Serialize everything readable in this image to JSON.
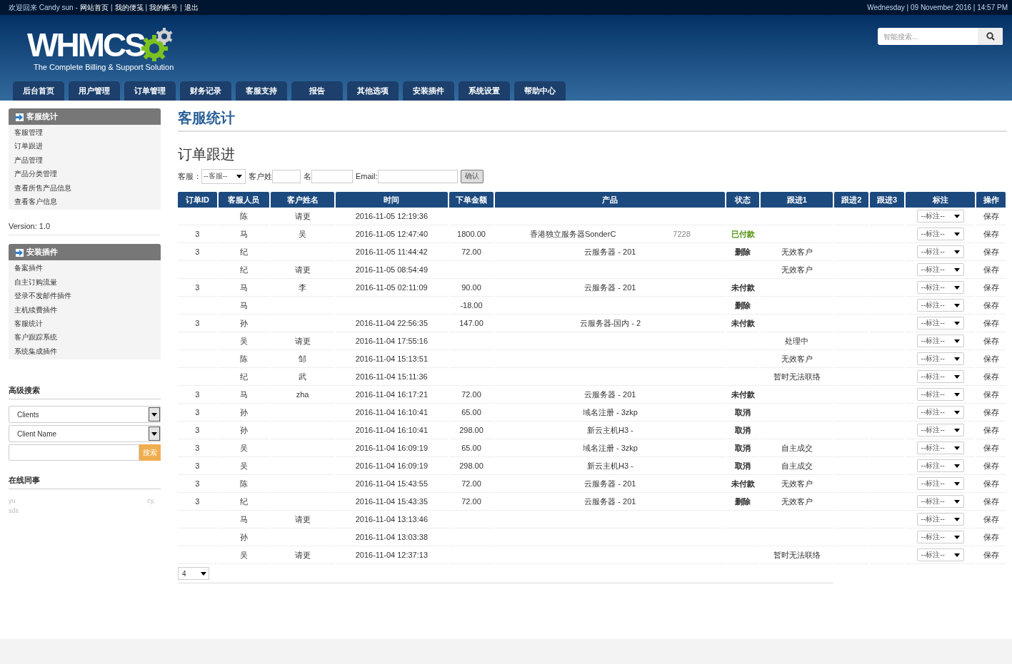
{
  "topbar": {
    "welcome": "欢迎回来 Candy sun",
    "dash": "-",
    "divider": "|",
    "links": [
      "网站首页",
      "我的便笺",
      "我的帐号",
      "退出"
    ],
    "datetime": "Wednesday | 09 November 2016 | 14:57 PM"
  },
  "header": {
    "logo": "WHMCS",
    "tagline": "The Complete Billing & Support Solution",
    "search": {
      "placeholder": "智能搜索..."
    }
  },
  "nav": [
    {
      "label": "后台首页",
      "selected": false
    },
    {
      "label": "用户管理",
      "selected": false
    },
    {
      "label": "订单管理",
      "selected": false
    },
    {
      "label": "财务记录",
      "selected": false
    },
    {
      "label": "客服支持",
      "selected": false
    },
    {
      "label": "报告",
      "selected": false
    },
    {
      "label": "其他选项",
      "selected": false
    },
    {
      "label": "安装插件",
      "selected": false
    },
    {
      "label": "系统设置",
      "selected": false
    },
    {
      "label": "帮助中心",
      "selected": false
    }
  ],
  "sidebar": {
    "panels": [
      {
        "title": "客服统计",
        "items": [
          "客服管理",
          "订单跟进",
          "产品管理",
          "产品分类管理",
          "查看所售产品信息",
          "查看客户信息"
        ],
        "footer": "Version: 1.0"
      },
      {
        "title": "安装插件",
        "items": [
          "备案插件",
          "自主订购流量",
          "登录不发邮件插件",
          "主机续费插件",
          "客服统计",
          "客户跟踪系统",
          "系统集成插件"
        ]
      }
    ],
    "advanced_search": {
      "title": "高级搜索",
      "selects": [
        "Clients",
        "Client Name"
      ],
      "button": "搜索"
    },
    "online": {
      "title": "在线同事",
      "names": [
        "yu",
        "sds"
      ],
      "suffix": "cy,"
    }
  },
  "main": {
    "title": "客服统计",
    "subtitle": "订单跟进",
    "filters": {
      "agent_label": "客服：",
      "agent_select": "--客服--",
      "last_label": "客户姓",
      "first_label": "名",
      "email_label": "Email:",
      "button": "确认"
    },
    "table": {
      "columns": [
        "订单ID",
        "客服人员",
        "客户姓名",
        "时间",
        "下单金额",
        "产品",
        "状态",
        "跟进1",
        "跟进2",
        "跟进3",
        "标注",
        "操作"
      ],
      "rows": [
        {
          "agent": "陈",
          "customer": "请更",
          "time": "2016-11-05 12:19:36",
          "remark": "--标注--",
          "action": "保存"
        },
        {
          "id": "3",
          "agent": "马",
          "customer": "吴",
          "time": "2016-11-05 12:47:40",
          "amount": "1800.00",
          "product": "香港独立服务器SonderC",
          "product_tail": "7228",
          "status": {
            "text": "已付款",
            "color": "#5a9a1a"
          },
          "remark": "--标注--",
          "action": "保存"
        },
        {
          "id": "3",
          "agent": "纪",
          "time": "2016-11-05 11:44:42",
          "amount": "72.00",
          "product": "云服务器 - 201",
          "status": {
            "text": "删除"
          },
          "follow1": "无效客户",
          "remark": "--标注--",
          "action": "保存"
        },
        {
          "agent": "纪",
          "customer": "请更",
          "time": "2016-11-05 08:54:49",
          "follow1": "无效客户",
          "remark": "--标注--",
          "action": "保存"
        },
        {
          "id": "3",
          "agent": "马",
          "customer": "李",
          "time": "2016-11-05 02:11:09",
          "amount": "90.00",
          "product": "云服务器 - 201",
          "status": {
            "text": "未付款"
          },
          "remark": "--标注--",
          "action": "保存"
        },
        {
          "agent": "马",
          "amount": "-18.00",
          "status": {
            "text": "删除"
          },
          "remark": "--标注--",
          "action": "保存"
        },
        {
          "id": "3",
          "agent": "孙",
          "time": "2016-11-04 22:56:35",
          "amount": "147.00",
          "product": "云服务器-国内 - 2",
          "status": {
            "text": "未付款"
          },
          "remark": "--标注--",
          "action": "保存"
        },
        {
          "agent": "吴",
          "customer": "请更",
          "time": "2016-11-04 17:55:16",
          "follow1": "处理中",
          "remark": "--标注--",
          "action": "保存"
        },
        {
          "agent": "陈",
          "customer": "邹",
          "time": "2016-11-04 15:13:51",
          "follow1": "无效客户",
          "remark": "--标注--",
          "action": "保存"
        },
        {
          "agent": "纪",
          "customer": "武",
          "time": "2016-11-04 15:11:36",
          "follow1": "暂时无法联络",
          "remark": "--标注--",
          "action": "保存"
        },
        {
          "id": "3",
          "agent": "马",
          "customer": "zha",
          "time": "2016-11-04 16:17:21",
          "amount": "72.00",
          "product": "云服务器 - 201",
          "status": {
            "text": "未付款"
          },
          "remark": "--标注--",
          "action": "保存"
        },
        {
          "id": "3",
          "agent": "孙",
          "time": "2016-11-04 16:10:41",
          "amount": "65.00",
          "product": "域名注册 - 3zkp",
          "status": {
            "text": "取消"
          },
          "remark": "--标注--",
          "action": "保存"
        },
        {
          "id": "3",
          "agent": "孙",
          "time": "2016-11-04 16:10:41",
          "amount": "298.00",
          "product": "新云主机H3 -",
          "status": {
            "text": "取消"
          },
          "remark": "--标注--",
          "action": "保存"
        },
        {
          "id": "3",
          "agent": "吴",
          "time": "2016-11-04 16:09:19",
          "amount": "65.00",
          "product": "域名注册 - 3zkp",
          "status": {
            "text": "取消"
          },
          "follow1": "自主成交",
          "remark": "--标注--",
          "action": "保存"
        },
        {
          "id": "3",
          "agent": "吴",
          "time": "2016-11-04 16:09:19",
          "amount": "298.00",
          "product": "新云主机H3 -",
          "status": {
            "text": "取消"
          },
          "follow1": "自主成交",
          "remark": "--标注--",
          "action": "保存"
        },
        {
          "id": "3",
          "agent": "陈",
          "time": "2016-11-04 15:43:55",
          "amount": "72.00",
          "product": "云服务器 - 201",
          "status": {
            "text": "未付款"
          },
          "follow1": "无效客户",
          "remark": "--标注--",
          "action": "保存"
        },
        {
          "id": "3",
          "agent": "纪",
          "time": "2016-11-04 15:43:35",
          "amount": "72.00",
          "product": "云服务器 - 201",
          "status": {
            "text": "删除"
          },
          "follow1": "无效客户",
          "remark": "--标注--",
          "action": "保存"
        },
        {
          "agent": "马",
          "customer": "请更",
          "time": "2016-11-04 13:13:46",
          "remark": "--标注--",
          "action": "保存"
        },
        {
          "agent": "孙",
          "time": "2016-11-04 13:03:38",
          "remark": "--标注--",
          "action": "保存"
        },
        {
          "agent": "吴",
          "customer": "请更",
          "time": "2016-11-04 12:37:13",
          "follow1": "暂时无法联络",
          "remark": "--标注--",
          "action": "保存"
        }
      ]
    },
    "pager": "4"
  }
}
